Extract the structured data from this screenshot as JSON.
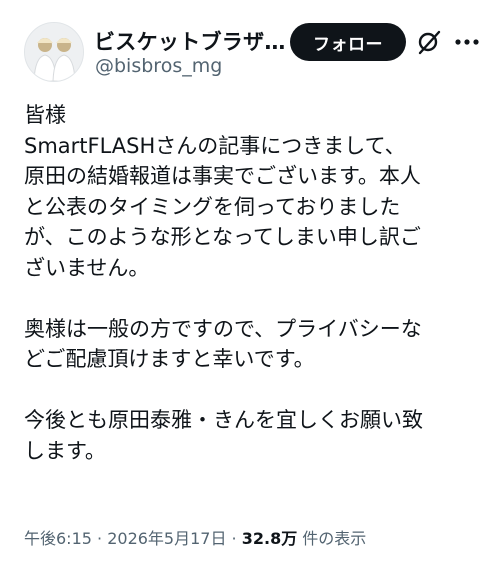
{
  "author": {
    "display_name": "ビスケットブラザ…",
    "handle": "@bisbros_mg",
    "avatar": "avatar-image"
  },
  "header": {
    "follow_label": "フォロー",
    "grok_icon": "grok-icon",
    "more_icon": "more-icon"
  },
  "post": {
    "text": "皆様\nSmartFLASHさんの記事につきまして、\n原田の結婚報道は事実でございます。本人\nと公表のタイミングを伺っておりました\nが、このような形となってしまい申し訳ご\nざいません。\n\n奥様は一般の方ですので、プライバシーな\nどご配慮頂けますと幸いです。\n\n今後とも原田泰雅・きんを宜しくお願い致\nします。"
  },
  "meta": {
    "time": "午後6:15",
    "sep1": " · ",
    "date": "2026年5月17日",
    "sep2": " · ",
    "views": "32.8万",
    "views_label": " 件の表示"
  }
}
